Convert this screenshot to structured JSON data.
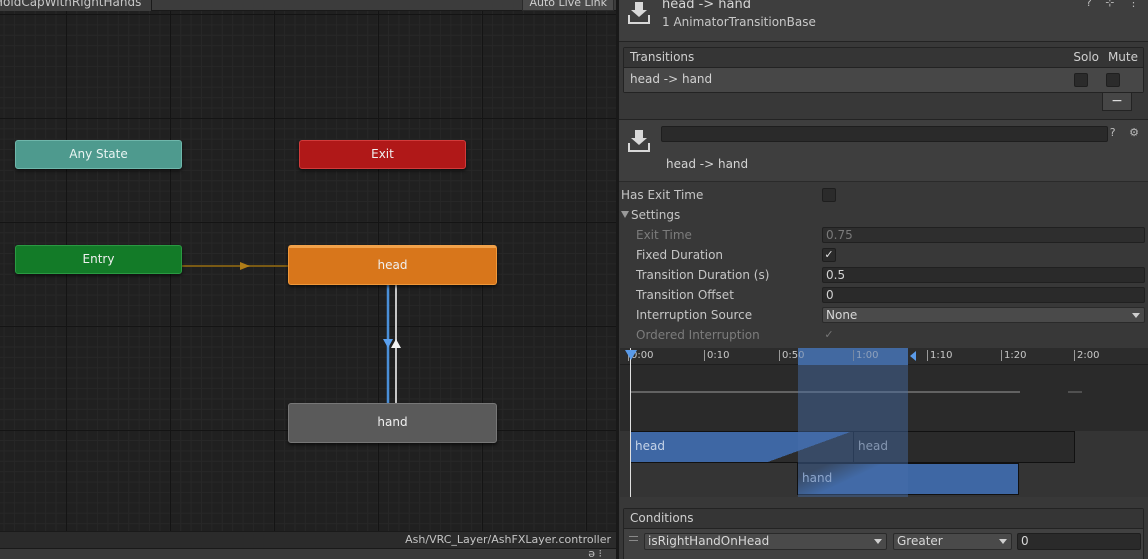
{
  "graph": {
    "layer_name": "HoldCapWithRightHands",
    "live_link_label": "Auto Live Link",
    "controller_path": "Ash/VRC_Layer/AshFXLayer.controller",
    "footer_icon": "ə ⁝",
    "nodes": {
      "any_state": "Any State",
      "exit": "Exit",
      "entry": "Entry",
      "head": "head",
      "hand": "hand"
    },
    "colors": {
      "any_state": "#4e9a8e",
      "exit": "#b01818",
      "entry": "#137b28",
      "head_selected": "#d8761b",
      "state": "#5a5a5a",
      "transition_selected": "#4a8fd8"
    }
  },
  "inspector": {
    "title": "head -> hand",
    "subtitle": "1 AnimatorTransitionBase",
    "header_icons": "? ⊹ ⋮",
    "transitions": {
      "header": "Transitions",
      "solo_label": "Solo",
      "mute_label": "Mute",
      "rows": [
        {
          "label": "head -> hand",
          "solo": false,
          "mute": false
        }
      ],
      "remove_label": "−"
    },
    "transition": {
      "name_value": "",
      "label": "head -> hand",
      "header_icons": "? ⚙"
    },
    "properties": {
      "has_exit_time_label": "Has Exit Time",
      "has_exit_time": false,
      "settings_label": "Settings",
      "exit_time_label": "Exit Time",
      "exit_time_value": "0.75",
      "fixed_duration_label": "Fixed Duration",
      "fixed_duration": true,
      "transition_duration_label": "Transition Duration (s)",
      "transition_duration_value": "0.5",
      "transition_offset_label": "Transition Offset",
      "transition_offset_value": "0",
      "interruption_source_label": "Interruption Source",
      "interruption_source_value": "None",
      "ordered_interruption_label": "Ordered Interruption",
      "ordered_interruption": true
    },
    "timeline": {
      "ticks": [
        "0:00",
        "0:10",
        "0:50",
        "1:00",
        "1:10",
        "1:20",
        "2:00"
      ],
      "clips": {
        "source_a": "head",
        "source_b": "head",
        "destination": "hand"
      }
    },
    "conditions": {
      "header": "Conditions",
      "rows": [
        {
          "parameter": "isRightHandOnHead",
          "mode": "Greater",
          "value": "0"
        }
      ]
    }
  }
}
